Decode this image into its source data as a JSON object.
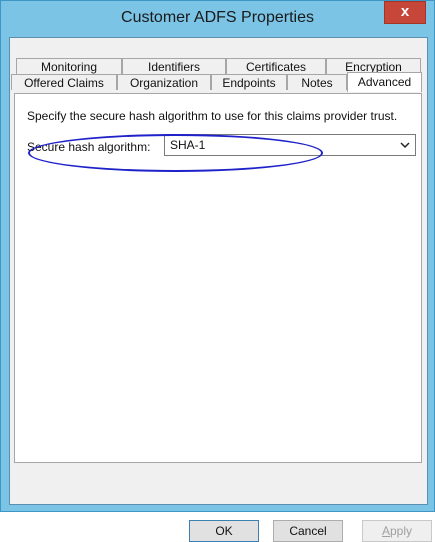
{
  "window": {
    "title": "Customer ADFS Properties",
    "close_glyph": "x"
  },
  "tabs": {
    "row1": [
      "Monitoring",
      "Identifiers",
      "Certificates",
      "Encryption"
    ],
    "row2": [
      "Offered Claims",
      "Organization",
      "Endpoints",
      "Notes",
      "Advanced"
    ],
    "active": "Advanced"
  },
  "advanced": {
    "description": "Specify the secure hash algorithm to use for this claims provider trust.",
    "hash_label": "Secure hash algorithm:",
    "hash_value": "SHA-1"
  },
  "buttons": {
    "ok": "OK",
    "cancel": "Cancel",
    "apply_prefix": "A",
    "apply_rest": "pply"
  },
  "colors": {
    "title_bar": "#7bc4e6",
    "close_button": "#c7463a",
    "highlight_ellipse": "#1f22c8"
  },
  "icons": {
    "close": "close-icon",
    "dropdown": "chevron-down-icon"
  }
}
